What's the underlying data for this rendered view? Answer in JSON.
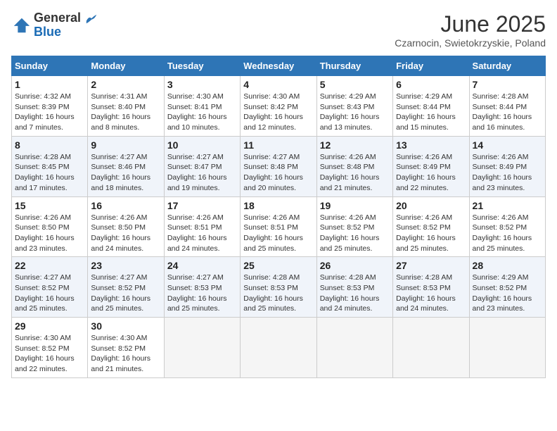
{
  "logo": {
    "general": "General",
    "blue": "Blue"
  },
  "title": "June 2025",
  "subtitle": "Czarnocin, Swietokrzyskie, Poland",
  "days_of_week": [
    "Sunday",
    "Monday",
    "Tuesday",
    "Wednesday",
    "Thursday",
    "Friday",
    "Saturday"
  ],
  "weeks": [
    [
      {
        "day": "1",
        "sunrise": "4:32 AM",
        "sunset": "8:39 PM",
        "daylight": "16 hours and 7 minutes."
      },
      {
        "day": "2",
        "sunrise": "4:31 AM",
        "sunset": "8:40 PM",
        "daylight": "16 hours and 8 minutes."
      },
      {
        "day": "3",
        "sunrise": "4:30 AM",
        "sunset": "8:41 PM",
        "daylight": "16 hours and 10 minutes."
      },
      {
        "day": "4",
        "sunrise": "4:30 AM",
        "sunset": "8:42 PM",
        "daylight": "16 hours and 12 minutes."
      },
      {
        "day": "5",
        "sunrise": "4:29 AM",
        "sunset": "8:43 PM",
        "daylight": "16 hours and 13 minutes."
      },
      {
        "day": "6",
        "sunrise": "4:29 AM",
        "sunset": "8:44 PM",
        "daylight": "16 hours and 15 minutes."
      },
      {
        "day": "7",
        "sunrise": "4:28 AM",
        "sunset": "8:44 PM",
        "daylight": "16 hours and 16 minutes."
      }
    ],
    [
      {
        "day": "8",
        "sunrise": "4:28 AM",
        "sunset": "8:45 PM",
        "daylight": "16 hours and 17 minutes."
      },
      {
        "day": "9",
        "sunrise": "4:27 AM",
        "sunset": "8:46 PM",
        "daylight": "16 hours and 18 minutes."
      },
      {
        "day": "10",
        "sunrise": "4:27 AM",
        "sunset": "8:47 PM",
        "daylight": "16 hours and 19 minutes."
      },
      {
        "day": "11",
        "sunrise": "4:27 AM",
        "sunset": "8:48 PM",
        "daylight": "16 hours and 20 minutes."
      },
      {
        "day": "12",
        "sunrise": "4:26 AM",
        "sunset": "8:48 PM",
        "daylight": "16 hours and 21 minutes."
      },
      {
        "day": "13",
        "sunrise": "4:26 AM",
        "sunset": "8:49 PM",
        "daylight": "16 hours and 22 minutes."
      },
      {
        "day": "14",
        "sunrise": "4:26 AM",
        "sunset": "8:49 PM",
        "daylight": "16 hours and 23 minutes."
      }
    ],
    [
      {
        "day": "15",
        "sunrise": "4:26 AM",
        "sunset": "8:50 PM",
        "daylight": "16 hours and 23 minutes."
      },
      {
        "day": "16",
        "sunrise": "4:26 AM",
        "sunset": "8:50 PM",
        "daylight": "16 hours and 24 minutes."
      },
      {
        "day": "17",
        "sunrise": "4:26 AM",
        "sunset": "8:51 PM",
        "daylight": "16 hours and 24 minutes."
      },
      {
        "day": "18",
        "sunrise": "4:26 AM",
        "sunset": "8:51 PM",
        "daylight": "16 hours and 25 minutes."
      },
      {
        "day": "19",
        "sunrise": "4:26 AM",
        "sunset": "8:52 PM",
        "daylight": "16 hours and 25 minutes."
      },
      {
        "day": "20",
        "sunrise": "4:26 AM",
        "sunset": "8:52 PM",
        "daylight": "16 hours and 25 minutes."
      },
      {
        "day": "21",
        "sunrise": "4:26 AM",
        "sunset": "8:52 PM",
        "daylight": "16 hours and 25 minutes."
      }
    ],
    [
      {
        "day": "22",
        "sunrise": "4:27 AM",
        "sunset": "8:52 PM",
        "daylight": "16 hours and 25 minutes."
      },
      {
        "day": "23",
        "sunrise": "4:27 AM",
        "sunset": "8:52 PM",
        "daylight": "16 hours and 25 minutes."
      },
      {
        "day": "24",
        "sunrise": "4:27 AM",
        "sunset": "8:53 PM",
        "daylight": "16 hours and 25 minutes."
      },
      {
        "day": "25",
        "sunrise": "4:28 AM",
        "sunset": "8:53 PM",
        "daylight": "16 hours and 25 minutes."
      },
      {
        "day": "26",
        "sunrise": "4:28 AM",
        "sunset": "8:53 PM",
        "daylight": "16 hours and 24 minutes."
      },
      {
        "day": "27",
        "sunrise": "4:28 AM",
        "sunset": "8:53 PM",
        "daylight": "16 hours and 24 minutes."
      },
      {
        "day": "28",
        "sunrise": "4:29 AM",
        "sunset": "8:52 PM",
        "daylight": "16 hours and 23 minutes."
      }
    ],
    [
      {
        "day": "29",
        "sunrise": "4:30 AM",
        "sunset": "8:52 PM",
        "daylight": "16 hours and 22 minutes."
      },
      {
        "day": "30",
        "sunrise": "4:30 AM",
        "sunset": "8:52 PM",
        "daylight": "16 hours and 21 minutes."
      },
      null,
      null,
      null,
      null,
      null
    ]
  ],
  "labels": {
    "sunrise": "Sunrise:",
    "sunset": "Sunset:",
    "daylight": "Daylight:"
  }
}
